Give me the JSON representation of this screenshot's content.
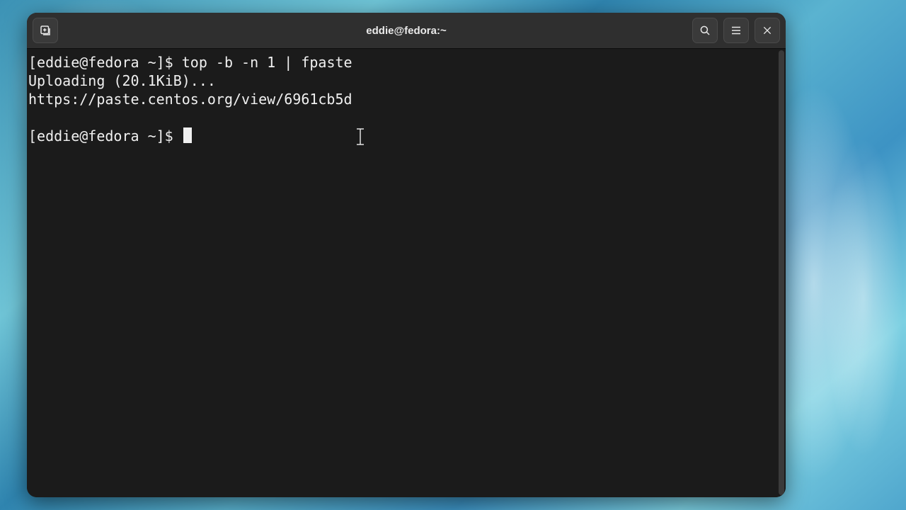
{
  "window": {
    "title": "eddie@fedora:~"
  },
  "toolbar": {
    "new_tab_label": "New Tab",
    "search_label": "Search",
    "menu_label": "Menu",
    "close_label": "Close"
  },
  "terminal": {
    "prompt1": "[eddie@fedora ~]$ ",
    "command1": "top -b -n 1 | fpaste",
    "out_line1": "Uploading (20.1KiB)...",
    "out_line2": "https://paste.centos.org/view/6961cb5d",
    "blank": "",
    "prompt2": "[eddie@fedora ~]$ "
  }
}
